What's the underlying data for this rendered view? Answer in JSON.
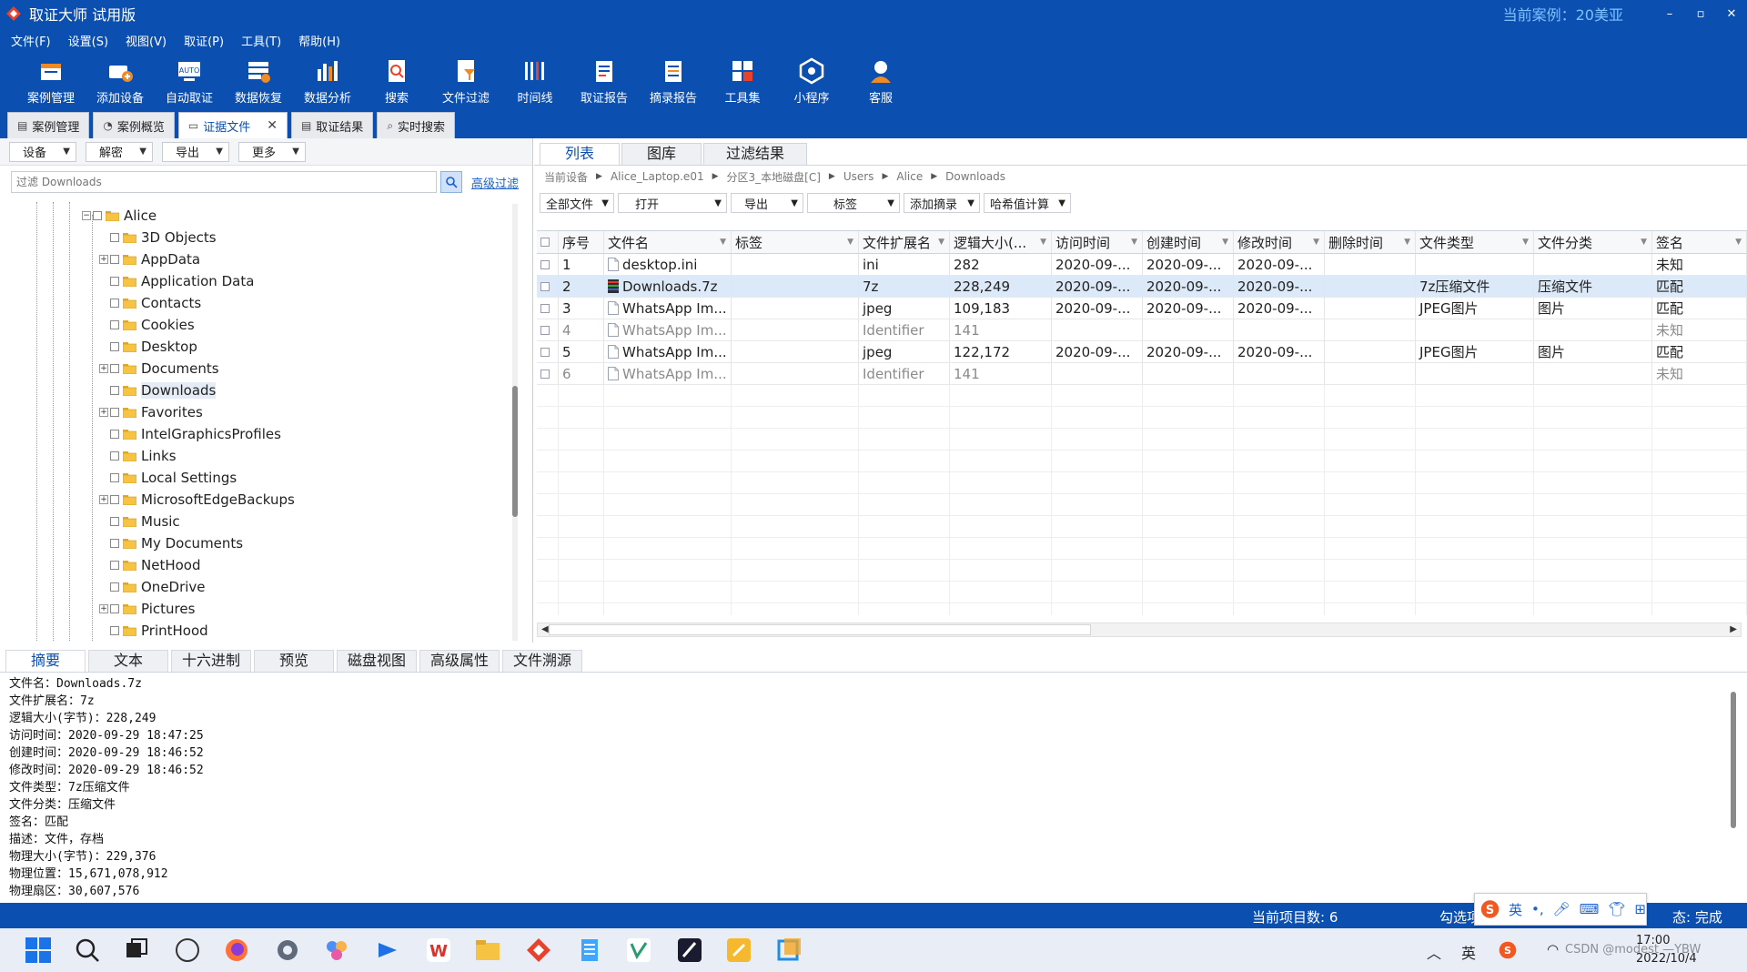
{
  "window": {
    "title": "取证大师 试用版",
    "current_case_label": "当前案例：20美亚",
    "controls": [
      "–",
      "▫",
      "✕"
    ]
  },
  "menu": [
    "文件(F)",
    "设置(S)",
    "视图(V)",
    "取证(P)",
    "工具(T)",
    "帮助(H)"
  ],
  "toolbar": [
    {
      "label": "案例管理",
      "icon": "case-manage-icon"
    },
    {
      "label": "添加设备",
      "icon": "add-device-icon"
    },
    {
      "label": "自动取证",
      "icon": "auto-forensics-icon"
    },
    {
      "label": "数据恢复",
      "icon": "data-recovery-icon"
    },
    {
      "label": "数据分析",
      "icon": "data-analysis-icon"
    },
    {
      "label": "搜索",
      "icon": "search-icon"
    },
    {
      "label": "文件过滤",
      "icon": "file-filter-icon"
    },
    {
      "label": "时间线",
      "icon": "timeline-icon"
    },
    {
      "label": "取证报告",
      "icon": "report-icon"
    },
    {
      "label": "摘录报告",
      "icon": "excerpt-report-icon"
    },
    {
      "label": "工具集",
      "icon": "toolset-icon"
    },
    {
      "label": "小程序",
      "icon": "mini-program-icon"
    },
    {
      "label": "客服",
      "icon": "customer-service-icon"
    }
  ],
  "doc_tabs": [
    {
      "label": "案例管理",
      "active": false
    },
    {
      "label": "案例概览",
      "active": false
    },
    {
      "label": "证据文件",
      "active": true
    },
    {
      "label": "取证结果",
      "active": false
    },
    {
      "label": "实时搜索",
      "active": false
    }
  ],
  "left_panel": {
    "buttons": [
      "设备",
      "解密",
      "导出",
      "更多"
    ],
    "filter_placeholder": "过滤 Downloads",
    "advanced_filter": "高级过滤",
    "tree": [
      {
        "label": "Alice",
        "level": 0,
        "expandable": true,
        "expanded": true
      },
      {
        "label": "3D Objects",
        "level": 1,
        "expandable": false
      },
      {
        "label": "AppData",
        "level": 1,
        "expandable": true
      },
      {
        "label": "Application Data",
        "level": 1,
        "expandable": false
      },
      {
        "label": "Contacts",
        "level": 1,
        "expandable": false
      },
      {
        "label": "Cookies",
        "level": 1,
        "expandable": false
      },
      {
        "label": "Desktop",
        "level": 1,
        "expandable": false
      },
      {
        "label": "Documents",
        "level": 1,
        "expandable": true
      },
      {
        "label": "Downloads",
        "level": 1,
        "expandable": false,
        "selected": true
      },
      {
        "label": "Favorites",
        "level": 1,
        "expandable": true
      },
      {
        "label": "IntelGraphicsProfiles",
        "level": 1,
        "expandable": false
      },
      {
        "label": "Links",
        "level": 1,
        "expandable": false
      },
      {
        "label": "Local Settings",
        "level": 1,
        "expandable": false
      },
      {
        "label": "MicrosoftEdgeBackups",
        "level": 1,
        "expandable": true
      },
      {
        "label": "Music",
        "level": 1,
        "expandable": false
      },
      {
        "label": "My Documents",
        "level": 1,
        "expandable": false
      },
      {
        "label": "NetHood",
        "level": 1,
        "expandable": false
      },
      {
        "label": "OneDrive",
        "level": 1,
        "expandable": false
      },
      {
        "label": "Pictures",
        "level": 1,
        "expandable": true
      },
      {
        "label": "PrintHood",
        "level": 1,
        "expandable": false
      }
    ]
  },
  "right_panel": {
    "view_tabs": [
      "列表",
      "图库",
      "过滤结果"
    ],
    "breadcrumb": [
      "当前设备",
      "Alice_Laptop.e01",
      "分区3_本地磁盘[C]",
      "Users",
      "Alice",
      "Downloads"
    ],
    "buttons": [
      "全部文件",
      "打开",
      "导出",
      "标签",
      "添加摘录",
      "哈希值计算"
    ],
    "columns": [
      "序号",
      "文件名",
      "标签",
      "文件扩展名",
      "逻辑大小(...",
      "访问时间",
      "创建时间",
      "修改时间",
      "删除时间",
      "文件类型",
      "文件分类",
      "签名"
    ],
    "rows": [
      {
        "no": "1",
        "name": "desktop.ini",
        "tag": "",
        "ext": "ini",
        "size": "282",
        "atime": "2020-09-...",
        "ctime": "2020-09-...",
        "mtime": "2020-09-...",
        "dtime": "",
        "type": "",
        "category": "",
        "sig": "未知",
        "gray": false,
        "selected": false,
        "icon": "doc-file-icon"
      },
      {
        "no": "2",
        "name": "Downloads.7z",
        "tag": "",
        "ext": "7z",
        "size": "228,249",
        "atime": "2020-09-...",
        "ctime": "2020-09-...",
        "mtime": "2020-09-...",
        "dtime": "",
        "type": "7z压缩文件",
        "category": "压缩文件",
        "sig": "匹配",
        "gray": false,
        "selected": true,
        "icon": "archive-file-icon"
      },
      {
        "no": "3",
        "name": "WhatsApp Im...",
        "tag": "",
        "ext": "jpeg",
        "size": "109,183",
        "atime": "2020-09-...",
        "ctime": "2020-09-...",
        "mtime": "2020-09-...",
        "dtime": "",
        "type": "JPEG图片",
        "category": "图片",
        "sig": "匹配",
        "gray": false,
        "selected": false,
        "icon": "doc-file-icon"
      },
      {
        "no": "4",
        "name": "WhatsApp Im...",
        "tag": "",
        "ext": "Identifier",
        "size": "141",
        "atime": "",
        "ctime": "",
        "mtime": "",
        "dtime": "",
        "type": "",
        "category": "",
        "sig": "未知",
        "gray": true,
        "selected": false,
        "icon": "doc-file-icon"
      },
      {
        "no": "5",
        "name": "WhatsApp Im...",
        "tag": "",
        "ext": "jpeg",
        "size": "122,172",
        "atime": "2020-09-...",
        "ctime": "2020-09-...",
        "mtime": "2020-09-...",
        "dtime": "",
        "type": "JPEG图片",
        "category": "图片",
        "sig": "匹配",
        "gray": false,
        "selected": false,
        "icon": "doc-file-icon"
      },
      {
        "no": "6",
        "name": "WhatsApp Im...",
        "tag": "",
        "ext": "Identifier",
        "size": "141",
        "atime": "",
        "ctime": "",
        "mtime": "",
        "dtime": "",
        "type": "",
        "category": "",
        "sig": "未知",
        "gray": true,
        "selected": false,
        "icon": "doc-file-icon"
      }
    ]
  },
  "detail": {
    "tabs": [
      "摘要",
      "文本",
      "十六进制",
      "预览",
      "磁盘视图",
      "高级属性",
      "文件溯源"
    ],
    "active_tab": "摘要",
    "lines": [
      "文件名：Downloads.7z",
      "文件扩展名：7z",
      "逻辑大小(字节)：228,249",
      "访问时间：2020-09-29 18:47:25",
      "创建时间：2020-09-29 18:46:52",
      "修改时间：2020-09-29 18:46:52",
      "文件类型：7z压缩文件",
      "文件分类：压缩文件",
      "签名：匹配",
      "描述：文件，存档",
      "物理大小(字节)：229,376",
      "物理位置：15,671,078,912",
      "物理扇区：30,607,576"
    ]
  },
  "statusbar": {
    "items_count": "当前项目数: 6",
    "checked": "勾选项",
    "status": "态: 完成"
  },
  "ime": {
    "lang": "英",
    "punct": "•,"
  },
  "taskbar": {
    "time": "17:00",
    "date": "2022/10/4",
    "tray_lang": "英",
    "watermark": "CSDN @modest —YBW"
  }
}
